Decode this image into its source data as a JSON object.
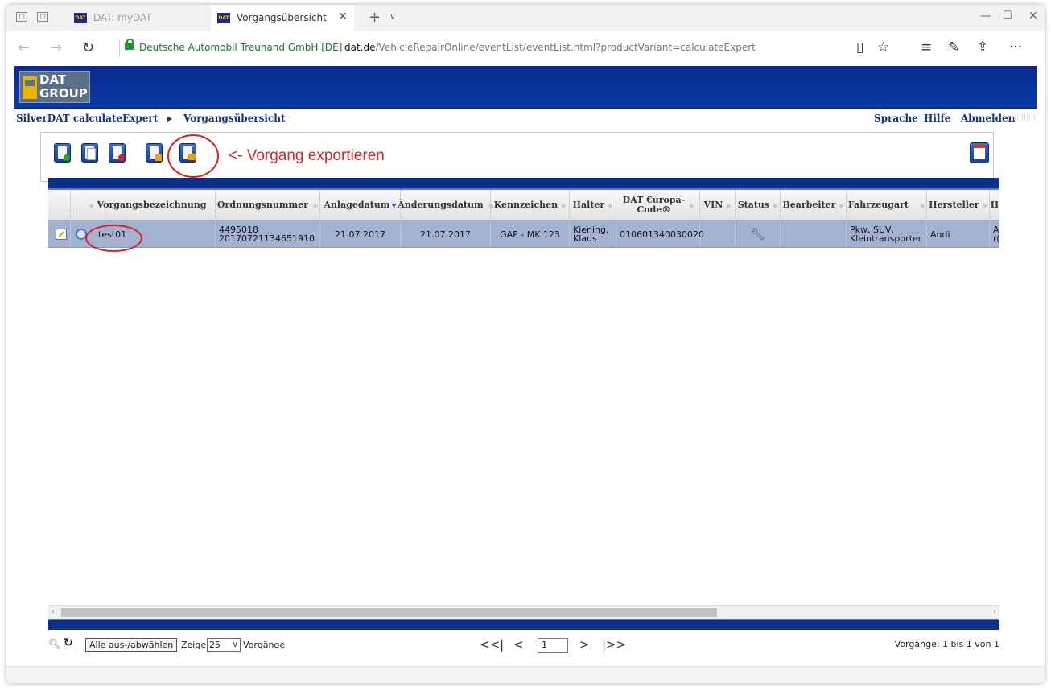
{
  "browser": {
    "tabs": [
      {
        "label": "DAT: myDAT"
      },
      {
        "label": "Vorgangsübersicht"
      }
    ],
    "site_identity": "Deutsche Automobil Treuhand GmbH [DE]",
    "url_domain": "dat.de",
    "url_path": "/VehicleRepairOnline/eventList/eventList.html?productVariant=calculateExpert"
  },
  "header": {
    "logo_line1": "DAT",
    "logo_line2": "GROUP"
  },
  "breadcrumb": {
    "product": "SilverDAT calculateExpert",
    "page": "Vorgangsübersicht"
  },
  "top_links": {
    "language": "Sprache",
    "help": "Hilfe",
    "logout": "Abmelden"
  },
  "annotation": {
    "export_hint": "<- Vorgang exportieren"
  },
  "table": {
    "columns": [
      "Vorgangsbezeichnung",
      "Ordnungsnummer",
      "Anlagedatum",
      "Änderungsdatum",
      "Kennzeichen",
      "Halter",
      "DAT €uropa-Code®",
      "VIN",
      "Status",
      "Bearbeiter",
      "Fahrzeugart",
      "Hersteller",
      "H"
    ],
    "rows": [
      {
        "name": "test01",
        "order_number_line1": "4495018",
        "order_number_line2": "20170721134651910",
        "created": "21.07.2017",
        "modified": "21.07.2017",
        "plate": "GAP - MK 123",
        "owner_line1": "Kiening,",
        "owner_line2": "Klaus",
        "europa_code": "010601340030020",
        "vin": "",
        "editor": "",
        "vehicle_type_line1": "Pkw, SUV,",
        "vehicle_type_line2": "Kleintransporter",
        "manufacturer": "Audi",
        "cut_line1": "A",
        "cut_line2": "(("
      }
    ]
  },
  "footer": {
    "select_all": "Alle aus-/abwählen",
    "show_label": "Zeige",
    "per_page": "25",
    "records_label": "Vorgänge",
    "pager_first": "<<|",
    "pager_prev": "<",
    "page_number": "1",
    "pager_next": ">",
    "pager_last": "|>>",
    "count": "Vorgänge: 1 bis 1 von 1"
  },
  "colors": {
    "brand_blue": "#0b2f8a",
    "selected_row": "#a4b2d2",
    "annotation_red": "#e02020"
  }
}
